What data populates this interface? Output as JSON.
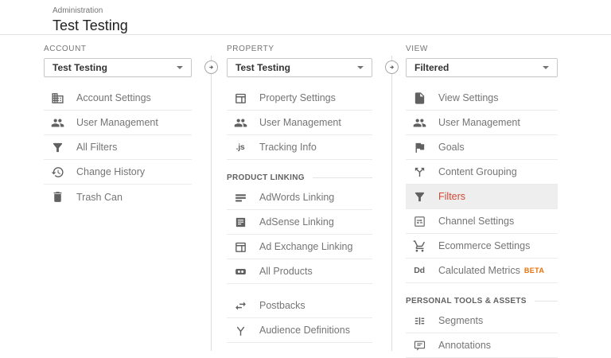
{
  "colors": {
    "active_item_text": "#d14836",
    "active_item_bg": "#eeeeee",
    "beta_badge": "#e8710a",
    "icon": "#616161",
    "divider": "#ebebeb"
  },
  "header": {
    "breadcrumb": "Administration",
    "title": "Test Testing"
  },
  "account": {
    "label": "ACCOUNT",
    "dropdown_value": "Test Testing",
    "items": [
      {
        "label": "Account Settings",
        "icon": "building-icon"
      },
      {
        "label": "User Management",
        "icon": "people-icon"
      },
      {
        "label": "All Filters",
        "icon": "funnel-icon"
      },
      {
        "label": "Change History",
        "icon": "history-icon"
      },
      {
        "label": "Trash Can",
        "icon": "trash-icon"
      }
    ]
  },
  "property": {
    "label": "PROPERTY",
    "dropdown_value": "Test Testing",
    "items": [
      {
        "label": "Property Settings",
        "icon": "window-icon"
      },
      {
        "label": "User Management",
        "icon": "people-icon"
      },
      {
        "label": "Tracking Info",
        "icon": "js-icon",
        "icon_text": ".js"
      }
    ],
    "product_linking": {
      "header": "PRODUCT LINKING",
      "items": [
        {
          "label": "AdWords Linking",
          "icon": "lines-card-icon"
        },
        {
          "label": "AdSense Linking",
          "icon": "adsense-box-icon"
        },
        {
          "label": "Ad Exchange Linking",
          "icon": "window-icon"
        },
        {
          "label": "All Products",
          "icon": "all-products-icon"
        }
      ]
    },
    "extra_items": [
      {
        "label": "Postbacks",
        "icon": "swap-arrows-icon"
      },
      {
        "label": "Audience Definitions",
        "icon": "branch-icon"
      }
    ]
  },
  "view": {
    "label": "VIEW",
    "dropdown_value": "Filtered",
    "items": [
      {
        "label": "View Settings",
        "icon": "document-icon"
      },
      {
        "label": "User Management",
        "icon": "people-icon"
      },
      {
        "label": "Goals",
        "icon": "flag-icon"
      },
      {
        "label": "Content Grouping",
        "icon": "split-icon"
      },
      {
        "label": "Filters",
        "icon": "funnel-icon",
        "active": true
      },
      {
        "label": "Channel Settings",
        "icon": "channel-icon"
      },
      {
        "label": "Ecommerce Settings",
        "icon": "cart-icon"
      },
      {
        "label": "Calculated Metrics",
        "icon": "dd-icon",
        "icon_text": "Dd",
        "badge": "BETA"
      }
    ],
    "personal": {
      "header": "PERSONAL TOOLS & ASSETS",
      "items": [
        {
          "label": "Segments",
          "icon": "segments-icon"
        },
        {
          "label": "Annotations",
          "icon": "speech-bubble-icon"
        }
      ]
    }
  }
}
